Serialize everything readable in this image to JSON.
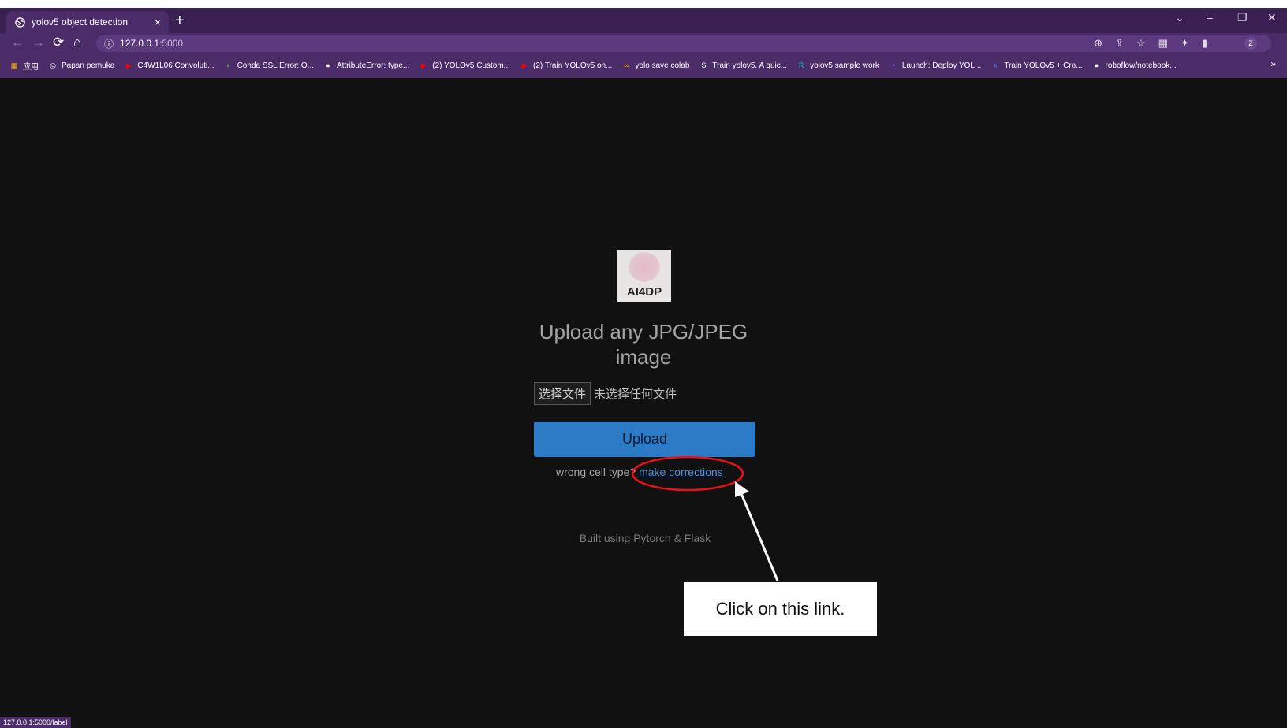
{
  "browser": {
    "tab_title": "yolov5 object detection",
    "tab_close": "×",
    "new_tab": "+",
    "url_host": "127.0.0.1",
    "url_port": ":5000",
    "status_url": "127.0.0.1:5000/label",
    "avatar_letter": "Z",
    "bookmarks": [
      {
        "label": "应用",
        "icon": "apps-icon",
        "color": "#f4b400"
      },
      {
        "label": "Papan pemuka",
        "icon": "globe-icon",
        "color": "#ffffff"
      },
      {
        "label": "C4W1L06 Convoluti...",
        "icon": "youtube-icon",
        "color": "#ff0000"
      },
      {
        "label": "Conda SSL Error: O...",
        "icon": "conda-icon",
        "color": "#43b02a"
      },
      {
        "label": "AttributeError: type...",
        "icon": "github-icon",
        "color": "#ffffff"
      },
      {
        "label": "(2) YOLOv5 Custom...",
        "icon": "youtube-icon",
        "color": "#ff0000"
      },
      {
        "label": "(2) Train YOLOv5 on...",
        "icon": "youtube-icon",
        "color": "#ff0000"
      },
      {
        "label": "yolo save colab",
        "icon": "colab-icon",
        "color": "#f9ab00"
      },
      {
        "label": "Train yolov5. A quic...",
        "icon": "s-icon",
        "color": "#ffffff"
      },
      {
        "label": "yolov5 sample work",
        "icon": "roboflow-icon",
        "color": "#17c3b2"
      },
      {
        "label": "Launch: Deploy YOL...",
        "icon": "launch-icon",
        "color": "#9b6bff"
      },
      {
        "label": "Train YOLOv5 + Cro...",
        "icon": "k-icon",
        "color": "#3a7bd5"
      },
      {
        "label": "roboflow/notebook...",
        "icon": "github-icon",
        "color": "#ffffff"
      }
    ],
    "more_bookmarks": "»"
  },
  "page": {
    "logo_text": "AI4DP",
    "heading": "Upload any JPG/JPEG image",
    "file_button": "选择文件",
    "file_status": "未选择任何文件",
    "upload_button": "Upload",
    "wrong_text": "wrong cell type?",
    "corrections_link": "make corrections",
    "footer": "Built using Pytorch & Flask"
  },
  "annotation": {
    "callout_text": "Click on this link.",
    "highlight_color": "#e8121b",
    "arrow_color": "#ffffff"
  }
}
